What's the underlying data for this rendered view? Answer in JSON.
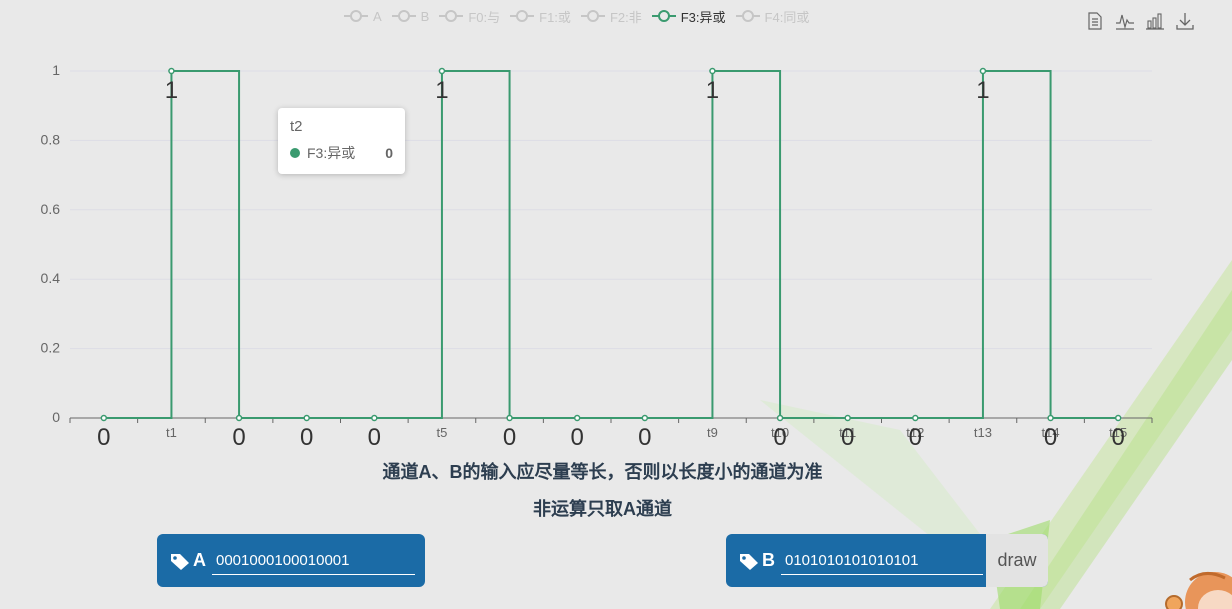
{
  "legend": [
    {
      "label": "A",
      "active": false
    },
    {
      "label": "B",
      "active": false
    },
    {
      "label": "F0:与",
      "active": false
    },
    {
      "label": "F1:或",
      "active": false
    },
    {
      "label": "F2:非",
      "active": false
    },
    {
      "label": "F3:异或",
      "active": true
    },
    {
      "label": "F4:同或",
      "active": false
    }
  ],
  "toolbox": [
    "data-view-icon",
    "line-chart-icon",
    "bar-chart-icon",
    "download-icon"
  ],
  "colors": {
    "series": "#3a9a6f",
    "panel": "#1b6ba6",
    "inactive": "#c6c6c6"
  },
  "chart_data": {
    "type": "line",
    "step": true,
    "x": [
      "",
      "t1",
      "",
      "",
      "",
      "t5",
      "",
      "",
      "",
      "t9",
      "t10",
      "t11",
      "t12",
      "t13",
      "t14",
      "t15"
    ],
    "series": [
      {
        "name": "F3:异或",
        "values": [
          0,
          1,
          0,
          0,
          0,
          1,
          0,
          0,
          0,
          1,
          0,
          0,
          0,
          1,
          0,
          0
        ]
      }
    ],
    "yticks": [
      "0",
      "0.2",
      "0.4",
      "0.6",
      "0.8",
      "1"
    ],
    "ylim": [
      0,
      1
    ]
  },
  "tooltip": {
    "title": "t2",
    "series": "F3:异或",
    "value": "0"
  },
  "notes": {
    "line1": "通道A、B的输入应尽量等长，否则以长度小的通道为准",
    "line2": "非运算只取A通道"
  },
  "inputs": {
    "a": {
      "label": "A",
      "value": "0001000100010001"
    },
    "b": {
      "label": "B",
      "value": "0101010101010101"
    }
  },
  "draw_label": "draw"
}
